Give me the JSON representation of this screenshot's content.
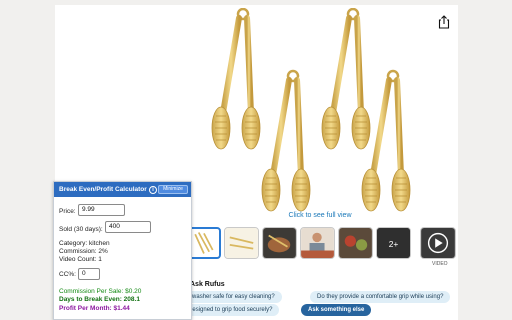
{
  "gallery": {
    "click_to_see": "Click to see full view",
    "video_label": "VIDEO",
    "more_count": "2+"
  },
  "rufus": {
    "heading": "Ask Rufus",
    "chip_1": "Are they dishwasher safe for easy cleaning?",
    "chip_2": "Do they provide a comfortable grip while using?",
    "chip_3": "Are the tips designed to grip food securely?",
    "chip_4": "Ask something else"
  },
  "calculator": {
    "title": "Break Even/Profit Calculator",
    "info_icon": "i",
    "minimize": "Minimize",
    "price_label": "Price:",
    "price_value": "9.99",
    "sold_label": "Sold (30 days):",
    "sold_value": "400",
    "category": "Category: kitchen",
    "commission": "Commission: 2%",
    "video_count": "Video Count: 1",
    "cc_label": "CC%:",
    "cc_value": "0",
    "commission_per_sale": "Commission Per Sale: $0.20",
    "days_to_break_even": "Days to Break Even: 208.1",
    "profit_per_month": "Profit Per Month: $1.44"
  },
  "colors": {
    "accent": "#2d6cc0",
    "gold": "#e3c46a",
    "green": "#138a13",
    "purple": "#8c18a0"
  }
}
